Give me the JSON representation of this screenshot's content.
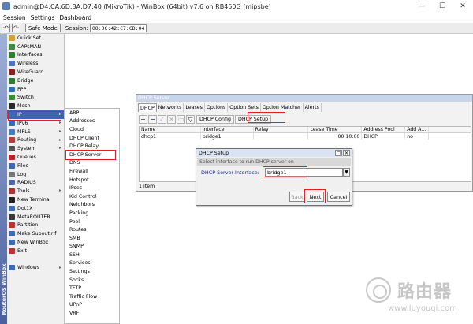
{
  "window": {
    "title": "admin@D4:CA:6D:3A:D7:40 (MikroTik) - WinBox (64bit) v7.6 on RB450G (mipsbe)",
    "min_glyph": "—",
    "max_glyph": "☐",
    "close_glyph": "✕"
  },
  "menubar": {
    "items": [
      "Session",
      "Settings",
      "Dashboard"
    ]
  },
  "toolbar": {
    "undo_glyph": "↶",
    "redo_glyph": "↷",
    "safe_mode_label": "Safe Mode",
    "session_label": "Session:",
    "session_value": "00:0C:42:C7:CD:04"
  },
  "vertical_brand": "RouterOS WinBox",
  "sidemenu": {
    "items": [
      {
        "label": "Quick Set",
        "icon": "quickset-icon",
        "color": "#d8a22a",
        "arrow": false
      },
      {
        "label": "CAPsMAN",
        "icon": "capsman-icon",
        "color": "#3f8c3f",
        "arrow": false
      },
      {
        "label": "Interfaces",
        "icon": "interfaces-icon",
        "color": "#2e7d32",
        "arrow": false
      },
      {
        "label": "Wireless",
        "icon": "wireless-icon",
        "color": "#4a78c0",
        "arrow": false
      },
      {
        "label": "WireGuard",
        "icon": "wireguard-icon",
        "color": "#8a2020",
        "arrow": false
      },
      {
        "label": "Bridge",
        "icon": "bridge-icon",
        "color": "#2e7d32",
        "arrow": false
      },
      {
        "label": "PPP",
        "icon": "ppp-icon",
        "color": "#2a6fc0",
        "arrow": false
      },
      {
        "label": "Switch",
        "icon": "switch-icon",
        "color": "#3a8a3a",
        "arrow": false
      },
      {
        "label": "Mesh",
        "icon": "mesh-icon",
        "color": "#2a2a2a",
        "arrow": false
      },
      {
        "label": "IP",
        "icon": "ip-icon",
        "color": "#3a6ab8",
        "arrow": true
      },
      {
        "label": "IPv6",
        "icon": "ipv6-icon",
        "color": "#3a6ab8",
        "arrow": true
      },
      {
        "label": "MPLS",
        "icon": "mpls-icon",
        "color": "#4a7ac0",
        "arrow": true
      },
      {
        "label": "Routing",
        "icon": "routing-icon",
        "color": "#c03a3a",
        "arrow": true
      },
      {
        "label": "System",
        "icon": "system-icon",
        "color": "#555555",
        "arrow": true
      },
      {
        "label": "Queues",
        "icon": "queues-icon",
        "color": "#c02020",
        "arrow": false
      },
      {
        "label": "Files",
        "icon": "files-icon",
        "color": "#3a6ab8",
        "arrow": false
      },
      {
        "label": "Log",
        "icon": "log-icon",
        "color": "#777777",
        "arrow": false
      },
      {
        "label": "RADIUS",
        "icon": "radius-icon",
        "color": "#4a6aa8",
        "arrow": false
      },
      {
        "label": "Tools",
        "icon": "tools-icon",
        "color": "#b03030",
        "arrow": true
      },
      {
        "label": "New Terminal",
        "icon": "terminal-icon",
        "color": "#222222",
        "arrow": false
      },
      {
        "label": "Dot1X",
        "icon": "dot1x-icon",
        "color": "#3a6ab8",
        "arrow": false
      },
      {
        "label": "MetaROUTER",
        "icon": "metarouter-icon",
        "color": "#3a3a3a",
        "arrow": false
      },
      {
        "label": "Partition",
        "icon": "partition-icon",
        "color": "#c03030",
        "arrow": false
      },
      {
        "label": "Make Supout.rif",
        "icon": "supout-icon",
        "color": "#3a6ab8",
        "arrow": false
      },
      {
        "label": "New WinBox",
        "icon": "winbox-icon",
        "color": "#3a6ab8",
        "arrow": false
      },
      {
        "label": "Exit",
        "icon": "exit-icon",
        "color": "#c03030",
        "arrow": false
      },
      {
        "label": "",
        "icon": "",
        "color": "",
        "arrow": false
      },
      {
        "label": "Windows",
        "icon": "windows-icon",
        "color": "#3a6ab8",
        "arrow": true
      }
    ]
  },
  "ip_submenu": {
    "items": [
      "ARP",
      "Addresses",
      "Cloud",
      "DHCP Client",
      "DHCP Relay",
      "DHCP Server",
      "DNS",
      "Firewall",
      "Hotspot",
      "IPsec",
      "Kid Control",
      "Neighbors",
      "Packing",
      "Pool",
      "Routes",
      "SMB",
      "SNMP",
      "SSH",
      "Services",
      "Settings",
      "Socks",
      "TFTP",
      "Traffic Flow",
      "UPnP",
      "VRF"
    ]
  },
  "dhcp_window": {
    "title": "DHCP Server",
    "tabs": [
      "DHCP",
      "Networks",
      "Leases",
      "Options",
      "Option Sets",
      "Option Matcher",
      "Alerts"
    ],
    "dhcp_config_label": "DHCP Config",
    "dhcp_setup_label": "DHCP Setup",
    "columns": [
      "Name",
      "Interface",
      "Relay",
      "Lease Time",
      "Address Pool",
      "Add A..."
    ],
    "rows": [
      [
        "dhcp1",
        "bridge1",
        "",
        "00:10:00",
        "DHCP",
        "no"
      ]
    ],
    "status": "1 item"
  },
  "setup_dialog": {
    "title": "DHCP Setup",
    "hint": "Select interface to run DHCP server on",
    "field_label": "DHCP Server Interface:",
    "field_value": "bridge1",
    "back_label": "Back",
    "next_label": "Next",
    "cancel_label": "Cancel"
  },
  "watermark": {
    "text": "路由器",
    "url": "www.luyouqi.com"
  }
}
